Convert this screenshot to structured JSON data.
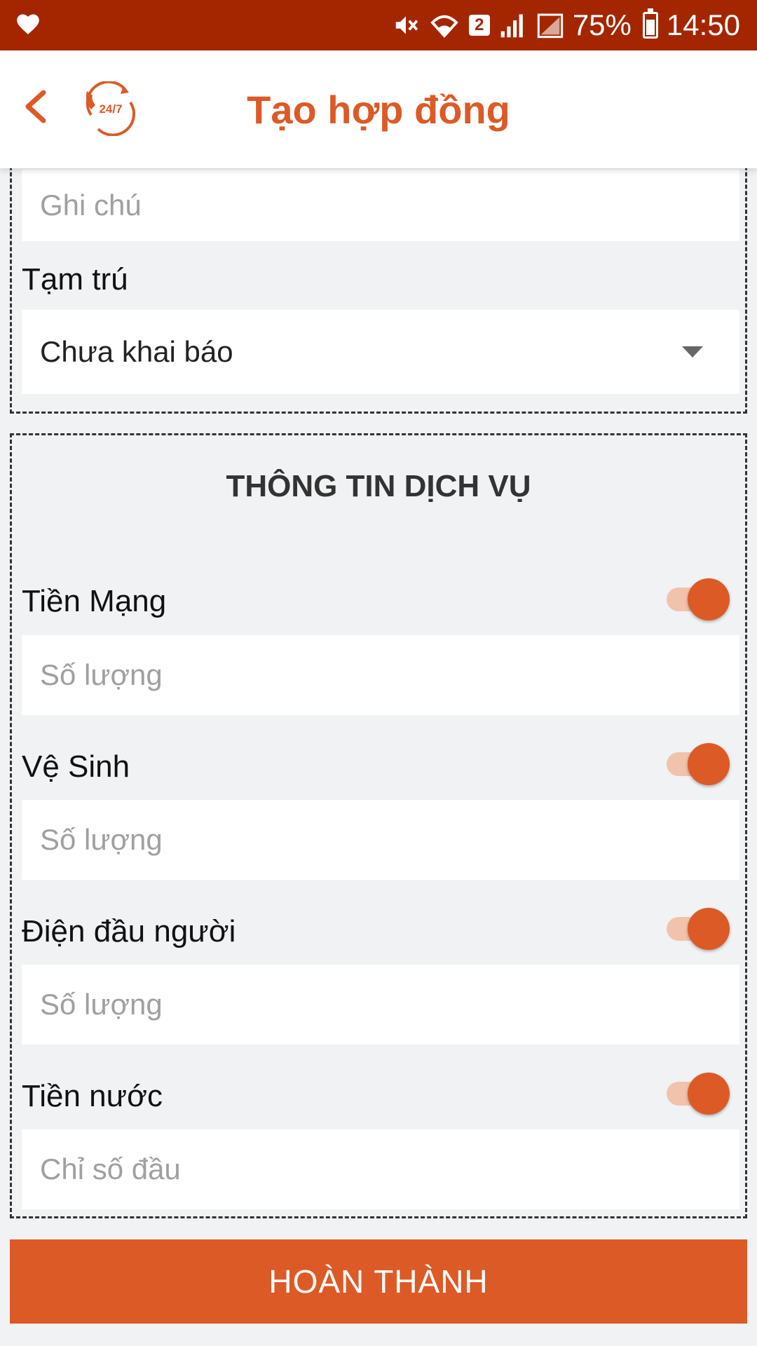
{
  "status_bar": {
    "battery_percent": "75%",
    "time": "14:50",
    "sim_slot": "2",
    "icons": [
      "heart-icon",
      "mute-icon",
      "wifi-icon",
      "signal-icon",
      "battery-icon"
    ]
  },
  "header": {
    "title": "Tạo hợp đồng",
    "logo_text": "24/7",
    "back_icon": "chevron-left-icon"
  },
  "form": {
    "note_placeholder": "Ghi chú",
    "residence_label": "Tạm trú",
    "residence_value": "Chưa khai báo"
  },
  "services": {
    "heading": "THÔNG TIN DỊCH VỤ",
    "items": [
      {
        "label": "Tiền Mạng",
        "enabled": true,
        "placeholder": "Số lượng"
      },
      {
        "label": "Vệ Sinh",
        "enabled": true,
        "placeholder": "Số lượng"
      },
      {
        "label": "Điện đầu người",
        "enabled": true,
        "placeholder": "Số lượng"
      },
      {
        "label": "Tiền nước",
        "enabled": true,
        "placeholder": "Chỉ số đầu"
      }
    ]
  },
  "actions": {
    "submit_label": "HOÀN THÀNH"
  },
  "colors": {
    "status_bar": "#a42600",
    "accent": "#dc5a26",
    "toggle_track": "#f1c3ad",
    "background": "#f1f2f4"
  }
}
